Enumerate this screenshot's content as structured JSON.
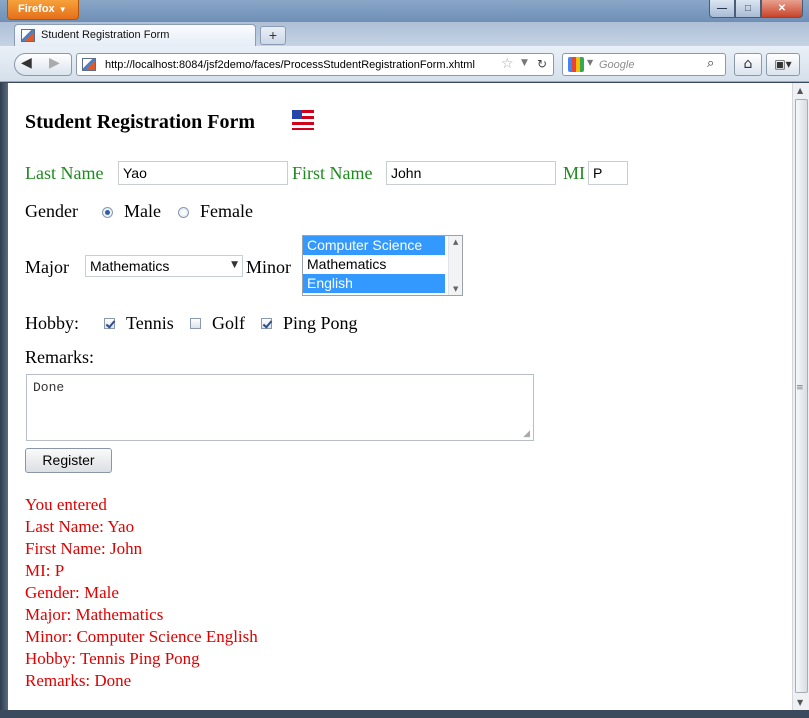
{
  "browser": {
    "app_button": "Firefox",
    "tab_title": "Student Registration Form",
    "url": "http://localhost:8084/jsf2demo/faces/ProcessStudentRegistrationForm.xhtml",
    "search_placeholder": "Google"
  },
  "form": {
    "title": "Student Registration Form",
    "last_name_label": "Last Name",
    "last_name_value": "Yao",
    "first_name_label": "First Name",
    "first_name_value": "John",
    "mi_label": "MI",
    "mi_value": "P",
    "gender_label": "Gender",
    "gender_options": [
      "Male",
      "Female"
    ],
    "gender_selected": "Male",
    "major_label": "Major",
    "major_value": "Mathematics",
    "minor_label": "Minor",
    "minor_options": [
      "Computer Science",
      "Mathematics",
      "English"
    ],
    "minor_selected": [
      "Computer Science",
      "English"
    ],
    "hobby_label": "Hobby:",
    "hobby_options": [
      "Tennis",
      "Golf",
      "Ping Pong"
    ],
    "hobby_checked": [
      "Tennis",
      "Ping Pong"
    ],
    "remarks_label": "Remarks:",
    "remarks_value": "Done",
    "register_label": "Register"
  },
  "results": [
    "You entered",
    "Last Name: Yao",
    "First Name: John",
    "MI: P",
    "Gender: Male",
    "Major: Mathematics",
    "Minor: Computer Science English",
    "Hobby: Tennis Ping Pong",
    "Remarks: Done"
  ],
  "colors": {
    "label_green": "#1f8a1f",
    "result_red": "#e00000",
    "selection_blue": "#3399ff"
  }
}
